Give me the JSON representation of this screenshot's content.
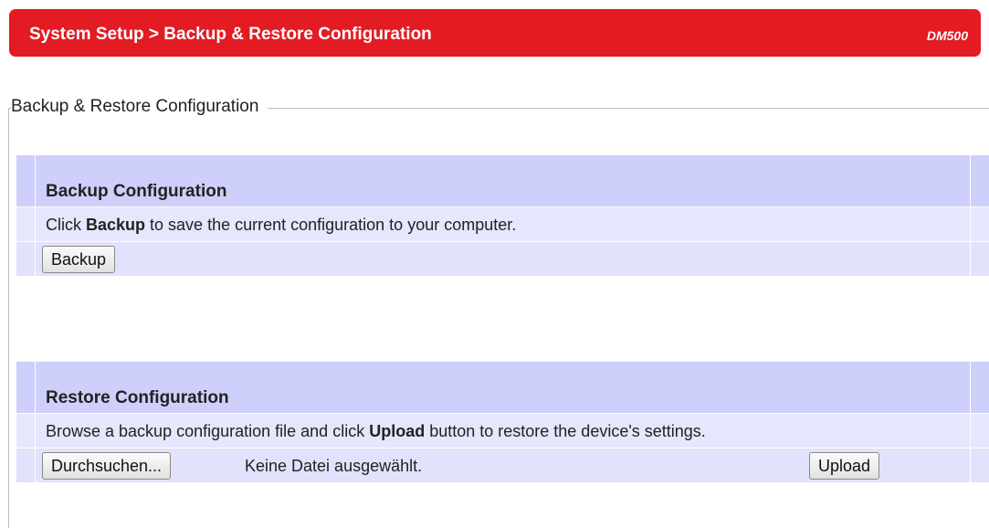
{
  "header": {
    "breadcrumb": "System Setup > Backup & Restore Configuration",
    "model": "DM500",
    "accent_color": "#e31b23"
  },
  "section": {
    "legend": "Backup & Restore Configuration"
  },
  "backup": {
    "title": "Backup Configuration",
    "desc_before": "Click ",
    "desc_bold": "Backup",
    "desc_after": " to save the current configuration to your computer.",
    "button_label": "Backup"
  },
  "restore": {
    "title": "Restore Configuration",
    "desc_before": "Browse a backup configuration file and click ",
    "desc_bold": "Upload",
    "desc_after": " button to restore the device's settings.",
    "browse_label": "Durchsuchen...",
    "file_status": "Keine Datei ausgewählt.",
    "upload_label": "Upload"
  },
  "colors": {
    "panel_header": "#cfcffb",
    "panel_row": "#e6e6fd"
  }
}
